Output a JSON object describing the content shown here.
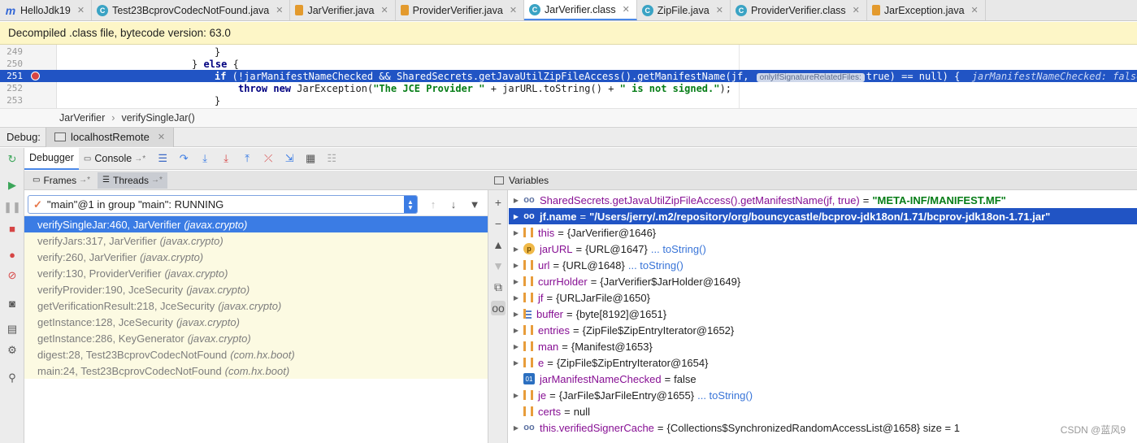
{
  "tabs": [
    {
      "label": "HelloJdk19",
      "icon": "module-icon",
      "type": "m"
    },
    {
      "label": "Test23BcprovCodecNotFound.java",
      "icon": "class-icon",
      "type": "c"
    },
    {
      "label": "JarVerifier.java",
      "icon": "java-file-icon",
      "type": "j"
    },
    {
      "label": "ProviderVerifier.java",
      "icon": "java-file-icon",
      "type": "j"
    },
    {
      "label": "JarVerifier.class",
      "icon": "class-icon",
      "type": "c",
      "active": true
    },
    {
      "label": "ZipFile.java",
      "icon": "class-icon",
      "type": "c"
    },
    {
      "label": "ProviderVerifier.class",
      "icon": "class-icon",
      "type": "c"
    },
    {
      "label": "JarException.java",
      "icon": "java-file-icon",
      "type": "j"
    }
  ],
  "banner": "Decompiled .class file, bytecode version: 63.0",
  "code": {
    "lines": [
      {
        "num": "249",
        "text": "}"
      },
      {
        "num": "250",
        "pre": "} ",
        "kw": "else",
        "post": " {"
      },
      {
        "num": "251",
        "kw": "if",
        "body": " (!jarManifestNameChecked && SharedSecrets.getJavaUtilZipFileAccess().getManifestName(jf, ",
        "hint": "onlyIfSignatureRelatedFiles:",
        "tail": "true) == null) {",
        "inline": "jarManifestNameChecked: false"
      },
      {
        "num": "252",
        "kw": "throw",
        "kw2": "new",
        "body": " JarException(",
        "s1": "\"The JCE Provider \"",
        "mid": " + jarURL.toString() + ",
        "s2": "\" is not signed.\"",
        "end": ");"
      },
      {
        "num": "253",
        "text": "}"
      }
    ]
  },
  "breadcrumb": [
    "JarVerifier",
    "verifySingleJar()"
  ],
  "debug": {
    "label": "Debug:",
    "session": "localhostRemote",
    "tabs": [
      "Debugger",
      "Console"
    ],
    "frames_tab": "Frames",
    "threads_tab": "Threads",
    "variables_title": "Variables",
    "thread": "\"main\"@1 in group \"main\": RUNNING"
  },
  "frames": [
    {
      "method": "verifySingleJar:460, JarVerifier",
      "pkg": "(javax.crypto)",
      "selected": true
    },
    {
      "method": "verifyJars:317, JarVerifier",
      "pkg": "(javax.crypto)"
    },
    {
      "method": "verify:260, JarVerifier",
      "pkg": "(javax.crypto)"
    },
    {
      "method": "verify:130, ProviderVerifier",
      "pkg": "(javax.crypto)"
    },
    {
      "method": "verifyProvider:190, JceSecurity",
      "pkg": "(javax.crypto)"
    },
    {
      "method": "getVerificationResult:218, JceSecurity",
      "pkg": "(javax.crypto)"
    },
    {
      "method": "getInstance:128, JceSecurity",
      "pkg": "(javax.crypto)"
    },
    {
      "method": "getInstance:286, KeyGenerator",
      "pkg": "(javax.crypto)"
    },
    {
      "method": "digest:28, Test23BcprovCodecNotFound",
      "pkg": "(com.hx.boot)"
    },
    {
      "method": "main:24, Test23BcprovCodecNotFound",
      "pkg": "(com.hx.boot)"
    }
  ],
  "variables": [
    {
      "icon": "watch",
      "expandable": true,
      "name": "SharedSecrets.getJavaUtilZipFileAccess().getManifestName(jf, true)",
      "value": "\"META-INF/MANIFEST.MF\"",
      "string": true
    },
    {
      "icon": "watch",
      "expandable": true,
      "name": "jf.name",
      "value": "\"/Users/jerry/.m2/repository/org/bouncycastle/bcprov-jdk18on/1.71/bcprov-jdk18on-1.71.jar\"",
      "string": true,
      "selected": true
    },
    {
      "icon": "field",
      "expandable": true,
      "name": "this",
      "value": "{JarVerifier@1646}"
    },
    {
      "icon": "param",
      "expandable": true,
      "name": "jarURL",
      "value": "{URL@1647}",
      "tostring": "... toString()"
    },
    {
      "icon": "field",
      "expandable": true,
      "name": "url",
      "value": "{URL@1648}",
      "tostring": "... toString()"
    },
    {
      "icon": "field",
      "expandable": true,
      "name": "currHolder",
      "value": "{JarVerifier$JarHolder@1649}"
    },
    {
      "icon": "field",
      "expandable": true,
      "name": "jf",
      "value": "{URLJarFile@1650}"
    },
    {
      "icon": "arr",
      "expandable": true,
      "name": "buffer",
      "value": "{byte[8192]@1651}"
    },
    {
      "icon": "field",
      "expandable": true,
      "name": "entries",
      "value": "{ZipFile$ZipEntryIterator@1652}"
    },
    {
      "icon": "field",
      "expandable": true,
      "name": "man",
      "value": "{Manifest@1653}"
    },
    {
      "icon": "field",
      "expandable": true,
      "name": "e",
      "value": "{ZipFile$ZipEntryIterator@1654}"
    },
    {
      "icon": "prim",
      "expandable": false,
      "name": "jarManifestNameChecked",
      "value": "false"
    },
    {
      "icon": "field",
      "expandable": true,
      "name": "je",
      "value": "{JarFile$JarFileEntry@1655}",
      "tostring": "... toString()"
    },
    {
      "icon": "field",
      "expandable": false,
      "name": "certs",
      "value": "null"
    },
    {
      "icon": "watch",
      "expandable": true,
      "name": "this.verifiedSignerCache",
      "value": "{Collections$SynchronizedRandomAccessList@1658}  size = 1"
    }
  ],
  "watermark": "CSDN @蓝风9",
  "colors": {
    "accent": "#3b7ce4",
    "selection": "#2154c4",
    "banner": "#fdf6c7",
    "frames_bg": "#fcfae2"
  }
}
